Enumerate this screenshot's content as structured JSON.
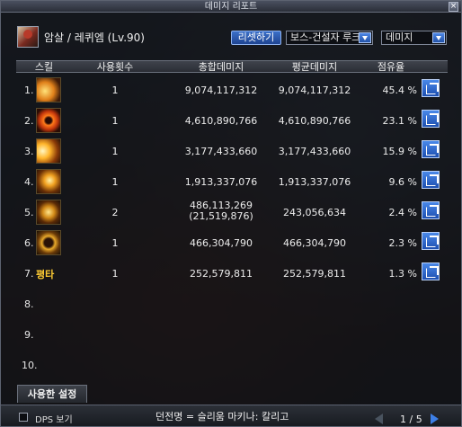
{
  "window": {
    "title": "데미지 리포트"
  },
  "character": {
    "name": "암살 / 레퀴엠 (Lv.90)"
  },
  "controls": {
    "reset_label": "리셋하기",
    "dungeon_select": "보스-건설자 루크",
    "metric_select": "데미지"
  },
  "table": {
    "headers": {
      "skill": "스킬",
      "uses": "사용횟수",
      "total": "총합데미지",
      "avg": "평균데미지",
      "share": "점유율"
    },
    "rows": [
      {
        "num": "1.",
        "icon": "crescent-slash-icon",
        "uses": "1",
        "total": "9,074,117,312",
        "total2": "",
        "avg": "9,074,117,312",
        "share": "45.4 %"
      },
      {
        "num": "2.",
        "icon": "orange-slash-icon",
        "uses": "1",
        "total": "4,610,890,766",
        "total2": "",
        "avg": "4,610,890,766",
        "share": "23.1 %"
      },
      {
        "num": "3.",
        "icon": "burst-icon",
        "uses": "1",
        "total": "3,177,433,660",
        "total2": "",
        "avg": "3,177,433,660",
        "share": "15.9 %"
      },
      {
        "num": "4.",
        "icon": "arc-strike-icon",
        "uses": "1",
        "total": "1,913,337,076",
        "total2": "",
        "avg": "1,913,337,076",
        "share": "9.6 %"
      },
      {
        "num": "5.",
        "icon": "swirl-icon",
        "uses": "2",
        "total": "486,113,269",
        "total2": "(21,519,876)",
        "avg": "243,056,634",
        "share": "2.4 %"
      },
      {
        "num": "6.",
        "icon": "ring-wave-icon",
        "uses": "1",
        "total": "466,304,790",
        "total2": "",
        "avg": "466,304,790",
        "share": "2.3 %"
      },
      {
        "num": "7.",
        "text": "평타",
        "uses": "1",
        "total": "252,579,811",
        "total2": "",
        "avg": "252,579,811",
        "share": "1.3 %"
      },
      {
        "num": "8."
      },
      {
        "num": "9."
      },
      {
        "num": "10."
      }
    ]
  },
  "settings_tab": "사용한 설정",
  "footer": {
    "dps_label": "DPS 보기",
    "dungeon": "던전명 = 슬리움 마키나: 칼리고",
    "page": "1 / 5"
  }
}
